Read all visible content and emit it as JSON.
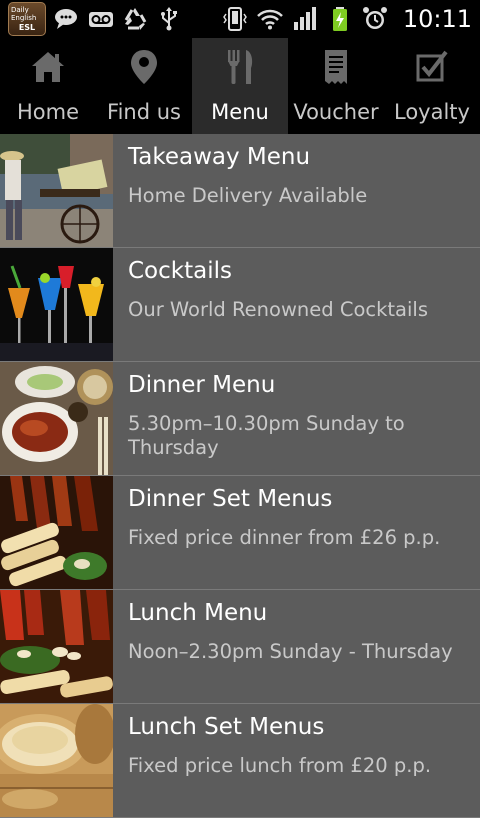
{
  "status_bar": {
    "app_badge": {
      "line1": "Daily",
      "line2": "English",
      "line3": "ESL"
    },
    "left_icons": [
      "chat-icon",
      "voicemail-icon",
      "recycle-icon",
      "usb-icon"
    ],
    "right_icons": [
      "vibrate-icon",
      "wifi-icon",
      "signal-icon",
      "battery-charging-icon",
      "alarm-icon"
    ],
    "time": "10:11"
  },
  "tabs": [
    {
      "label": "Home",
      "icon": "home-icon",
      "active": false
    },
    {
      "label": "Find us",
      "icon": "map-pin-icon",
      "active": false
    },
    {
      "label": "Menu",
      "icon": "fork-knife-icon",
      "active": true
    },
    {
      "label": "Voucher",
      "icon": "voucher-icon",
      "active": false
    },
    {
      "label": "Loyalty",
      "icon": "checkbox-icon",
      "active": false
    }
  ],
  "menu_items": [
    {
      "title": "Takeaway Menu",
      "subtitle": "Home Delivery Available"
    },
    {
      "title": "Cocktails",
      "subtitle": "Our World Renowned Cocktails"
    },
    {
      "title": "Dinner Menu",
      "subtitle": "5.30pm–10.30pm Sunday to Thursday"
    },
    {
      "title": "Dinner Set Menus",
      "subtitle": "Fixed price dinner from £26 p.p."
    },
    {
      "title": "Lunch Menu",
      "subtitle": "Noon–2.30pm Sunday - Thursday"
    },
    {
      "title": "Lunch Set Menus",
      "subtitle": "Fixed price lunch from £20 p.p."
    }
  ],
  "colors": {
    "list_background": "#5c5c5c",
    "tab_bar_background": "#000000",
    "active_tab_background": "#2b2b2b",
    "subtitle_text": "#c9c9c9"
  }
}
